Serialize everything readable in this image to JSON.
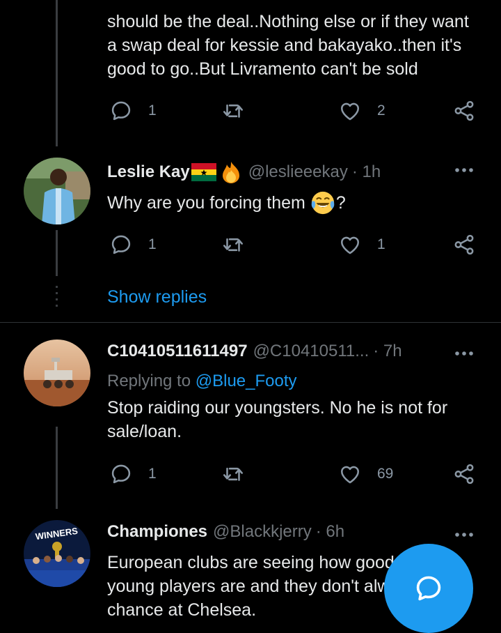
{
  "tweet1": {
    "lines": [
      "should be the deal..Nothing else or if they want",
      "a swap deal for kessie and bakayako..then it's",
      "good to go..But Livramento can't be sold"
    ],
    "replies": "1",
    "likes": "2"
  },
  "tweet2": {
    "name": "Leslie Kay",
    "handle": "@leslieeekay",
    "time": "· 1h",
    "text_before": "Why are you forcing them",
    "text_after": "?",
    "replies": "1",
    "likes": "1",
    "emoji_icons": [
      "ghana-flag-icon",
      "fire-icon",
      "tears-of-joy-icon"
    ]
  },
  "show_replies_label": "Show replies",
  "tweet3": {
    "name": "C10410511611497",
    "handle": "@C10410511...",
    "time": "· 7h",
    "replying_prefix": "Replying to",
    "replying_to": "@Blue_Footy",
    "lines": [
      "Stop raiding our youngsters. No he is not for",
      "sale/loan."
    ],
    "replies": "1",
    "likes": "69"
  },
  "tweet4": {
    "name": "Championes",
    "handle": "@Blackkjerry",
    "time": "· 6h",
    "avatar_banner": "WINNERS",
    "lines": [
      "European clubs are seeing how good",
      "young players are and they don't alw",
      "chance at Chelsea."
    ]
  },
  "icons": {
    "reply": "reply-icon",
    "retweet": "retweet-icon",
    "like": "heart-icon",
    "share": "share-icon",
    "more": "more-options-icon",
    "compose": "compose-reply-icon"
  },
  "colors": {
    "background": "#000000",
    "text": "#e7e9ea",
    "muted": "#71767b",
    "accent": "#1d9bf0"
  }
}
